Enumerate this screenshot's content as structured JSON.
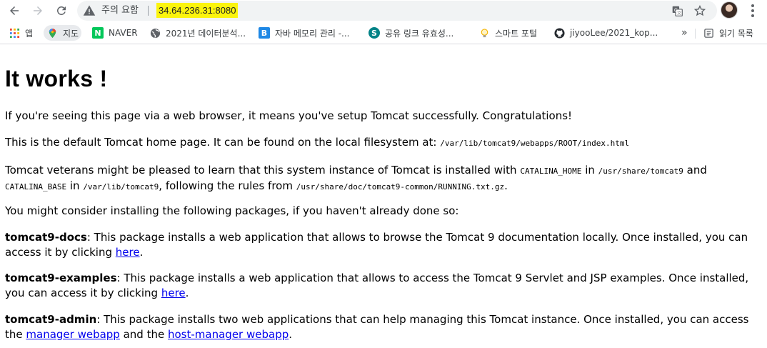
{
  "browser": {
    "security_label": "주의 요함",
    "url": "34.64.236.31:8080",
    "bookmarks": [
      {
        "label": "앱",
        "icon": "apps-grid-icon"
      },
      {
        "label": "지도",
        "icon": "maps-icon"
      },
      {
        "label": "NAVER",
        "icon": "naver-icon"
      },
      {
        "label": "2021년 데이터분석...",
        "icon": "globe-icon"
      },
      {
        "label": "자바 메모리 관리 -...",
        "icon": "blogger-icon"
      },
      {
        "label": "공유 링크 유효성...",
        "icon": "sharepoint-icon"
      },
      {
        "label": "스마트 포털",
        "icon": "lightbulb-icon"
      },
      {
        "label": "jiyooLee/2021_kop...",
        "icon": "github-icon"
      }
    ],
    "overflow_label": "»",
    "reading_list_label": "읽기 목록"
  },
  "page": {
    "title": "It works !",
    "p1": "If you're seeing this page via a web browser, it means you've setup Tomcat successfully. Congratulations!",
    "p2_text": "This is the default Tomcat home page. It can be found on the local filesystem at: ",
    "p2_path": "/var/lib/tomcat9/webapps/ROOT/index.html",
    "p3_a": "Tomcat veterans might be pleased to learn that this system instance of Tomcat is installed with ",
    "p3_catalina_home": "CATALINA_HOME",
    "p3_b": " in ",
    "p3_home_path": "/usr/share/tomcat9",
    "p3_c": " and",
    "p3_catalina_base": "CATALINA_BASE",
    "p3_d": " in ",
    "p3_base_path": "/var/lib/tomcat9",
    "p3_e": ", following the rules from ",
    "p3_running_path": "/usr/share/doc/tomcat9-common/RUNNING.txt.gz",
    "p3_f": ".",
    "p4": "You might consider installing the following packages, if you haven't already done so:",
    "docs_name": "tomcat9-docs",
    "docs_text": ": This package installs a web application that allows to browse the Tomcat 9 documentation locally. Once installed, you can access it by clicking ",
    "docs_link": "here",
    "examples_name": "tomcat9-examples",
    "examples_text": ": This package installs a web application that allows to access the Tomcat 9 Servlet and JSP examples. Once installed, you can access it by clicking ",
    "examples_link": "here",
    "admin_name": "tomcat9-admin",
    "admin_text": ": This package installs two web applications that can help managing this Tomcat instance. Once installed, you can access the ",
    "admin_link1": "manager webapp",
    "admin_mid": " and the ",
    "admin_link2": "host-manager webapp",
    "period": "."
  },
  "colors": {
    "url_highlight": "#fbf40d",
    "link": "#0000ee"
  }
}
